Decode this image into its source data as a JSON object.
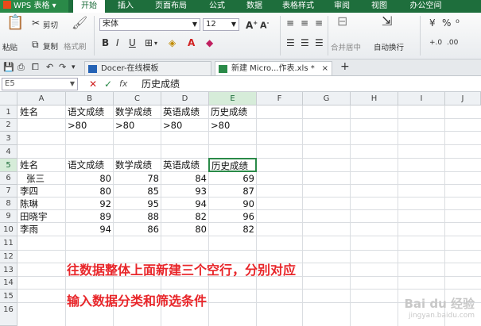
{
  "app": {
    "title": "WPS 表格"
  },
  "menu": [
    "开始",
    "插入",
    "页面布局",
    "公式",
    "数据",
    "表格样式",
    "审阅",
    "视图",
    "办公空间"
  ],
  "ribbon": {
    "paste": "粘贴",
    "cut": "剪切",
    "copy": "复制",
    "format_painter": "格式刷",
    "font_name": "宋体",
    "font_size": "12",
    "merge_center": "合并居中",
    "auto_wrap": "自动换行"
  },
  "tabs": [
    {
      "label": "Docer-在线模板"
    },
    {
      "label": "新建 Micro...作表.xls *"
    }
  ],
  "formula_bar": {
    "cell_ref": "E5",
    "fx": "fx",
    "content": "历史成绩"
  },
  "columns": [
    "A",
    "B",
    "C",
    "D",
    "E",
    "F",
    "G",
    "H",
    "I",
    "J"
  ],
  "rows": [
    "1",
    "2",
    "3",
    "4",
    "5",
    "6",
    "7",
    "8",
    "9",
    "10",
    "11",
    "12",
    "13",
    "14",
    "15",
    "16"
  ],
  "cells": {
    "r1": [
      "姓名",
      "语文成绩",
      "数学成绩",
      "英语成绩",
      "历史成绩"
    ],
    "r2": [
      "",
      ">80",
      ">80",
      ">80",
      ">80"
    ],
    "r5": [
      "姓名",
      "语文成绩",
      "数学成绩",
      "英语成绩",
      "历史成绩"
    ],
    "data": [
      {
        "name": "张三",
        "v": [
          "80",
          "78",
          "84",
          "69"
        ]
      },
      {
        "name": "李四",
        "v": [
          "80",
          "85",
          "93",
          "87"
        ]
      },
      {
        "name": "陈琳",
        "v": [
          "92",
          "95",
          "94",
          "90"
        ]
      },
      {
        "name": "田晓宇",
        "v": [
          "89",
          "88",
          "82",
          "96"
        ]
      },
      {
        "name": "李雨",
        "v": [
          "94",
          "86",
          "80",
          "82"
        ]
      }
    ]
  },
  "annotation": {
    "line1": "往数据整体上面新建三个空行，分别对应",
    "line2": "输入数据分类和筛选条件"
  },
  "watermark": {
    "text": "Bai du 经验",
    "sub": "jingyan.baidu.com"
  },
  "colors": {
    "wps_green": "#1e6e3c",
    "annotation_red": "#e8262a"
  }
}
